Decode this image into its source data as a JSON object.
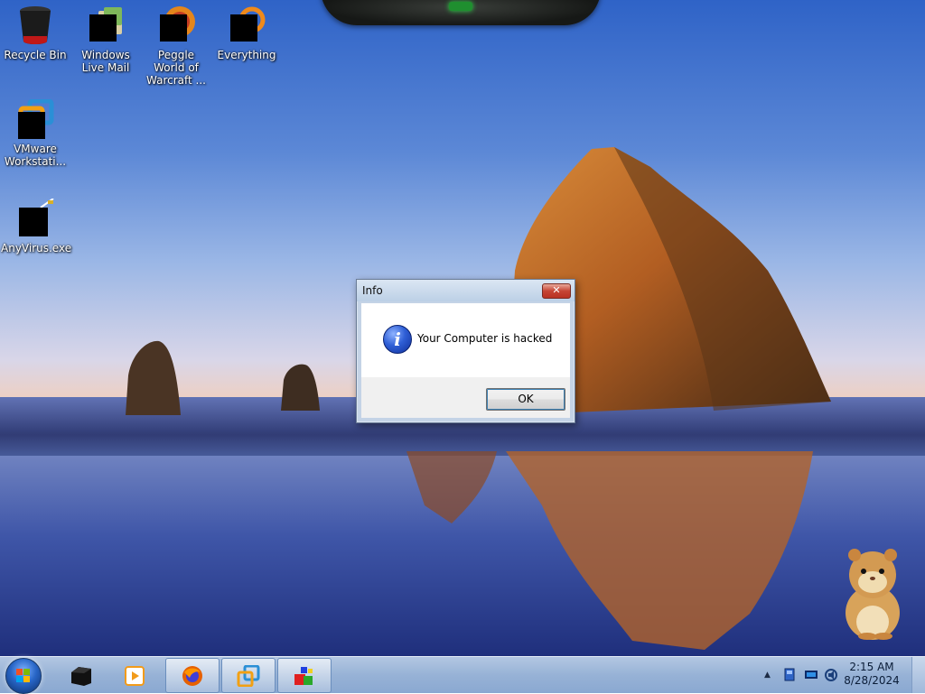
{
  "dialog": {
    "title": "Info",
    "close_glyph": "✕",
    "message": "Your Computer is hacked",
    "ok_label": "OK",
    "icon": "info-icon"
  },
  "desktop_icons": [
    {
      "label": "Recycle Bin",
      "icon": "recycle-bin-icon"
    },
    {
      "label": "Windows Live Mail",
      "icon": "mail-icon"
    },
    {
      "label": "Peggle World of Warcraft ...",
      "icon": "peggle-icon"
    },
    {
      "label": "Everything",
      "icon": "search-app-icon"
    },
    {
      "label": "VMware Workstati...",
      "icon": "vmware-icon"
    },
    {
      "label": "AnyVirus.exe",
      "icon": "executable-icon"
    }
  ],
  "taskbar": {
    "items": [
      "start-orb",
      "black-app-icon",
      "media-player-icon",
      "firefox-icon",
      "vmware-icon",
      "app-cubes-icon"
    ],
    "tray_arrow": "▲",
    "clock_time": "2:15 AM",
    "clock_date": "8/28/2024"
  },
  "colors": {
    "taskbar": "#97b2d6",
    "dialog_border": "#6b7d97",
    "close_button": "#c64434"
  }
}
